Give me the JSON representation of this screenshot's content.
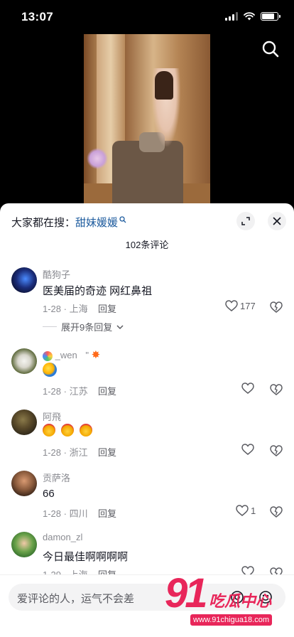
{
  "status_bar": {
    "time": "13:07"
  },
  "sheet": {
    "search_prefix": "大家都在搜：",
    "search_keyword": "甜妹媛媛",
    "comment_count": "102条评论"
  },
  "comments": [
    {
      "name": "酷狗子",
      "text": "医美届的奇迹 网红鼻祖",
      "date": "1-28",
      "location": "上海",
      "reply": "回复",
      "likes": "177",
      "expand": "展开9条回复"
    },
    {
      "name": "_wen",
      "name_suffix": "\"",
      "text": "",
      "date": "1-28",
      "location": "江苏",
      "reply": "回复",
      "likes": ""
    },
    {
      "name": "阿飛",
      "text": "",
      "date": "1-28",
      "location": "浙江",
      "reply": "回复",
      "likes": ""
    },
    {
      "name": "贡萨洛",
      "text": "66",
      "date": "1-28",
      "location": "四川",
      "reply": "回复",
      "likes": "1"
    },
    {
      "name": "damon_zl",
      "text": "今日最佳啊啊啊啊",
      "date": "1-29",
      "location": "上海",
      "reply": "回复",
      "likes": ""
    }
  ],
  "input": {
    "placeholder": "爱评论的人，运气不会差"
  },
  "watermark": {
    "num": "91",
    "text": "吃瓜中心",
    "url": "www.91chigua18.com"
  },
  "colors": {
    "accent_link": "#1d5b9e",
    "watermark": "#e8265a",
    "muted": "#8a8b91"
  },
  "icons": [
    "search-icon",
    "expand-icon",
    "close-icon",
    "heart-icon",
    "dislike-icon",
    "chevron-down-icon",
    "at-icon",
    "emoji-icon"
  ]
}
